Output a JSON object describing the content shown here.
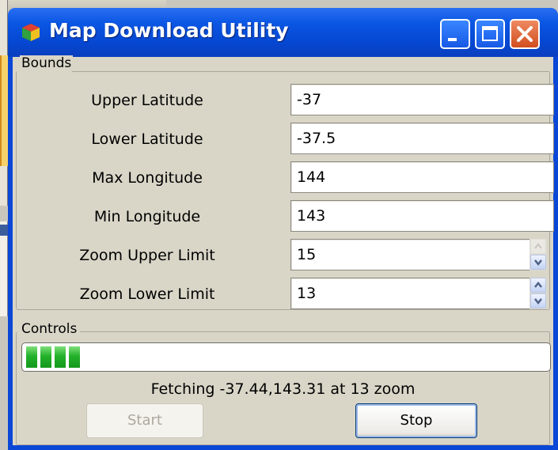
{
  "window": {
    "title": "Map Download Utility",
    "icons": {
      "app": "cube-icon",
      "minimize": "minimize-icon",
      "maximize": "maximize-icon",
      "close": "close-icon"
    }
  },
  "bounds": {
    "legend": "Bounds",
    "rows": [
      {
        "label": "Upper Latitude",
        "value": "-37"
      },
      {
        "label": "Lower Latitude",
        "value": "-37.5"
      },
      {
        "label": "Max Longitude",
        "value": "144"
      },
      {
        "label": "Min Longitude",
        "value": "143"
      },
      {
        "label": "Zoom Upper Limit",
        "value": "15"
      },
      {
        "label": "Zoom Lower Limit",
        "value": "13"
      }
    ]
  },
  "controls": {
    "legend": "Controls",
    "progress_fraction": 0.12,
    "status": "Fetching -37.44,143.31 at 13 zoom",
    "start_label": "Start",
    "stop_label": "Stop"
  },
  "colors": {
    "titlebar": "#0a47d6",
    "progress": "#24b12b",
    "close_button": "#d24e1e"
  }
}
